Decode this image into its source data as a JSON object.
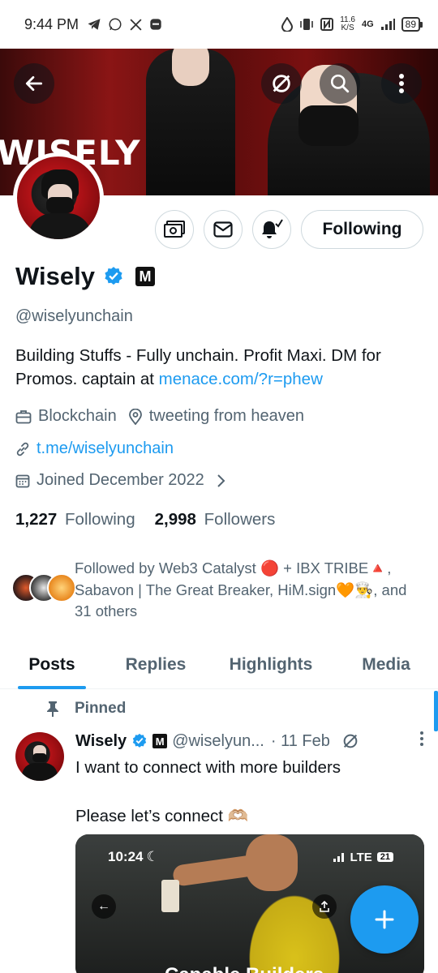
{
  "status_bar": {
    "time": "9:44 PM",
    "net_speed_value": "11.6",
    "net_speed_unit": "K/S",
    "network": "4G",
    "battery": "89"
  },
  "banner": {
    "text": "WISELY"
  },
  "profile": {
    "name": "Wisely",
    "badge": "M",
    "handle": "@wiselyunchain",
    "bio_text": "Building Stuffs  - Fully unchain. Profit Maxi. DM for Promos. captain at ",
    "bio_link": "menace.com/?r=phew",
    "category": "Blockchain",
    "location": "tweeting from heaven",
    "website": "t.me/wiselyunchain",
    "joined": "Joined December 2022",
    "following_count": "1,227",
    "following_label": "Following",
    "followers_count": "2,998",
    "followers_label": "Followers",
    "followed_by": "Followed by Web3 Catalyst 🔴 + IBX TRIBE🔺, Sabavon | The Great Breaker, HiM.sign🧡👨‍🍳, and 31 others"
  },
  "actions": {
    "following_button": "Following"
  },
  "tabs": [
    {
      "label": "Posts"
    },
    {
      "label": "Replies"
    },
    {
      "label": "Highlights"
    },
    {
      "label": "Media"
    }
  ],
  "pinned_post": {
    "pinned_label": "Pinned",
    "name": "Wisely",
    "badge": "M",
    "handle": "@wiselyun...",
    "date": "· 11 Feb",
    "text": "I want to connect with more builders\n\nPlease let’s connect 🫶🏼",
    "media": {
      "time": "10:24",
      "network": "LTE",
      "battery": "21",
      "caption": "Capable Builders"
    }
  },
  "colors": {
    "accent": "#1d9bf0",
    "text_primary": "#0f1419",
    "text_secondary": "#536471"
  }
}
